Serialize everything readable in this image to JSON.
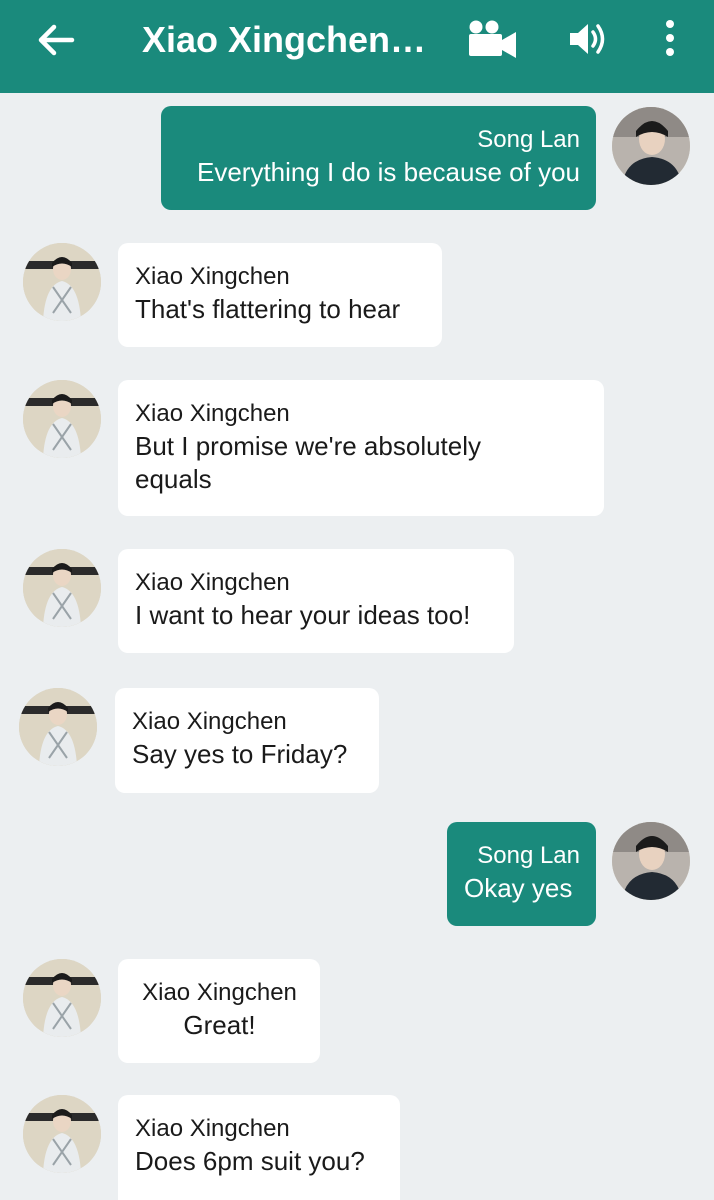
{
  "header": {
    "title": "Xiao Xingchen…",
    "icons": [
      "back-arrow-icon",
      "video-camera-icon",
      "speaker-icon",
      "more-vert-icon"
    ],
    "color": "#1a8a7c"
  },
  "messages": [
    {
      "sender": "Song Lan",
      "text": "Everything I do is because of you",
      "direction": "outgoing"
    },
    {
      "sender": "Xiao Xingchen",
      "text": "That's flattering to hear",
      "direction": "incoming"
    },
    {
      "sender": "Xiao Xingchen",
      "text": "But I promise we're absolutely equals",
      "direction": "incoming"
    },
    {
      "sender": "Xiao Xingchen",
      "text": "I want to hear your ideas too!",
      "direction": "incoming"
    },
    {
      "sender": "Xiao Xingchen",
      "text": "Say yes to Friday?",
      "direction": "incoming"
    },
    {
      "sender": "Song Lan",
      "text": "Okay yes",
      "direction": "outgoing"
    },
    {
      "sender": "Xiao Xingchen",
      "text": "Great!",
      "direction": "incoming"
    },
    {
      "sender": "Xiao Xingchen",
      "text": "Does 6pm suit you?",
      "direction": "incoming"
    }
  ]
}
